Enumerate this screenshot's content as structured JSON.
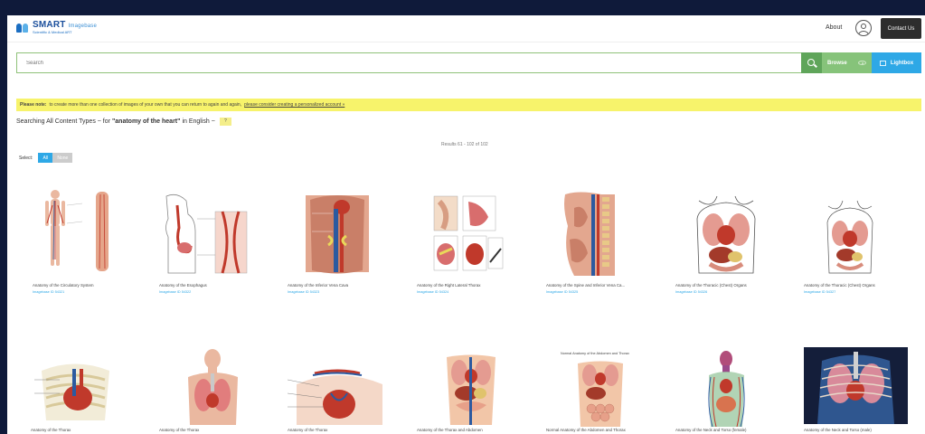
{
  "header": {
    "logo_title": "SMART",
    "logo_title_small": "Imagebase",
    "logo_sub": "Scientific & Medical ART",
    "about": "About",
    "contact": "Contact Us"
  },
  "search": {
    "placeholder": "Search",
    "browse": "Browse",
    "lightbox": "Lightbox"
  },
  "notice": {
    "bold": "Please note:",
    "text": "to create more than one collection of images of your own that you can return to again and again,",
    "link": "please consider creating a personalized account »"
  },
  "searching": {
    "prefix": "Searching All Content Types ~ for",
    "query": "\"anatomy of the heart\"",
    "suffix": "in English ~",
    "help": "?"
  },
  "results_text": "Results 61 - 102 of 102",
  "select": {
    "label": "Select:",
    "all": "All",
    "none": "None"
  },
  "row1": [
    {
      "caption": "Anatomy of the Circulatory System",
      "sub": "Imagebase ID 54321"
    },
    {
      "caption": "Anatomy of the Esophagus",
      "sub": "Imagebase ID 54322"
    },
    {
      "caption": "Anatomy of the Inferior Vena Cava",
      "sub": "Imagebase ID 54323"
    },
    {
      "caption": "Anatomy of the Right Lateral Thorax",
      "sub": "Imagebase ID 54324"
    },
    {
      "caption": "Anatomy of the Spine and Inferior Vena Ca...",
      "sub": "Imagebase ID 54325"
    },
    {
      "caption": "Anatomy of the Thoracic (Chest) Organs",
      "sub": "Imagebase ID 54326"
    },
    {
      "caption": "Anatomy of the Thoracic (Chest) Organs",
      "sub": "Imagebase ID 54327"
    }
  ],
  "row2": [
    {
      "caption": "Anatomy of the Thorax"
    },
    {
      "caption": "Anatomy of the Thorax"
    },
    {
      "caption": "Anatomy of the Thorax"
    },
    {
      "caption": "Anatomy of the Thorax and Abdomen"
    },
    {
      "caption": "Normal Anatomy of the Abdomen and Thorax"
    },
    {
      "caption": "Anatomy of the Neck and Torso (female)"
    },
    {
      "caption": "Anatomy of the Neck and Torso (male)"
    }
  ],
  "row2_top_label": "Normal Anatomy of the Abdomen and Thorax",
  "colors": {
    "search_green": "#5fa55a",
    "browse_green": "#86c37a",
    "lightbox_blue": "#2ea8e6",
    "notice_yellow": "#f7f36b",
    "page_bg": "#0f1a3a"
  }
}
